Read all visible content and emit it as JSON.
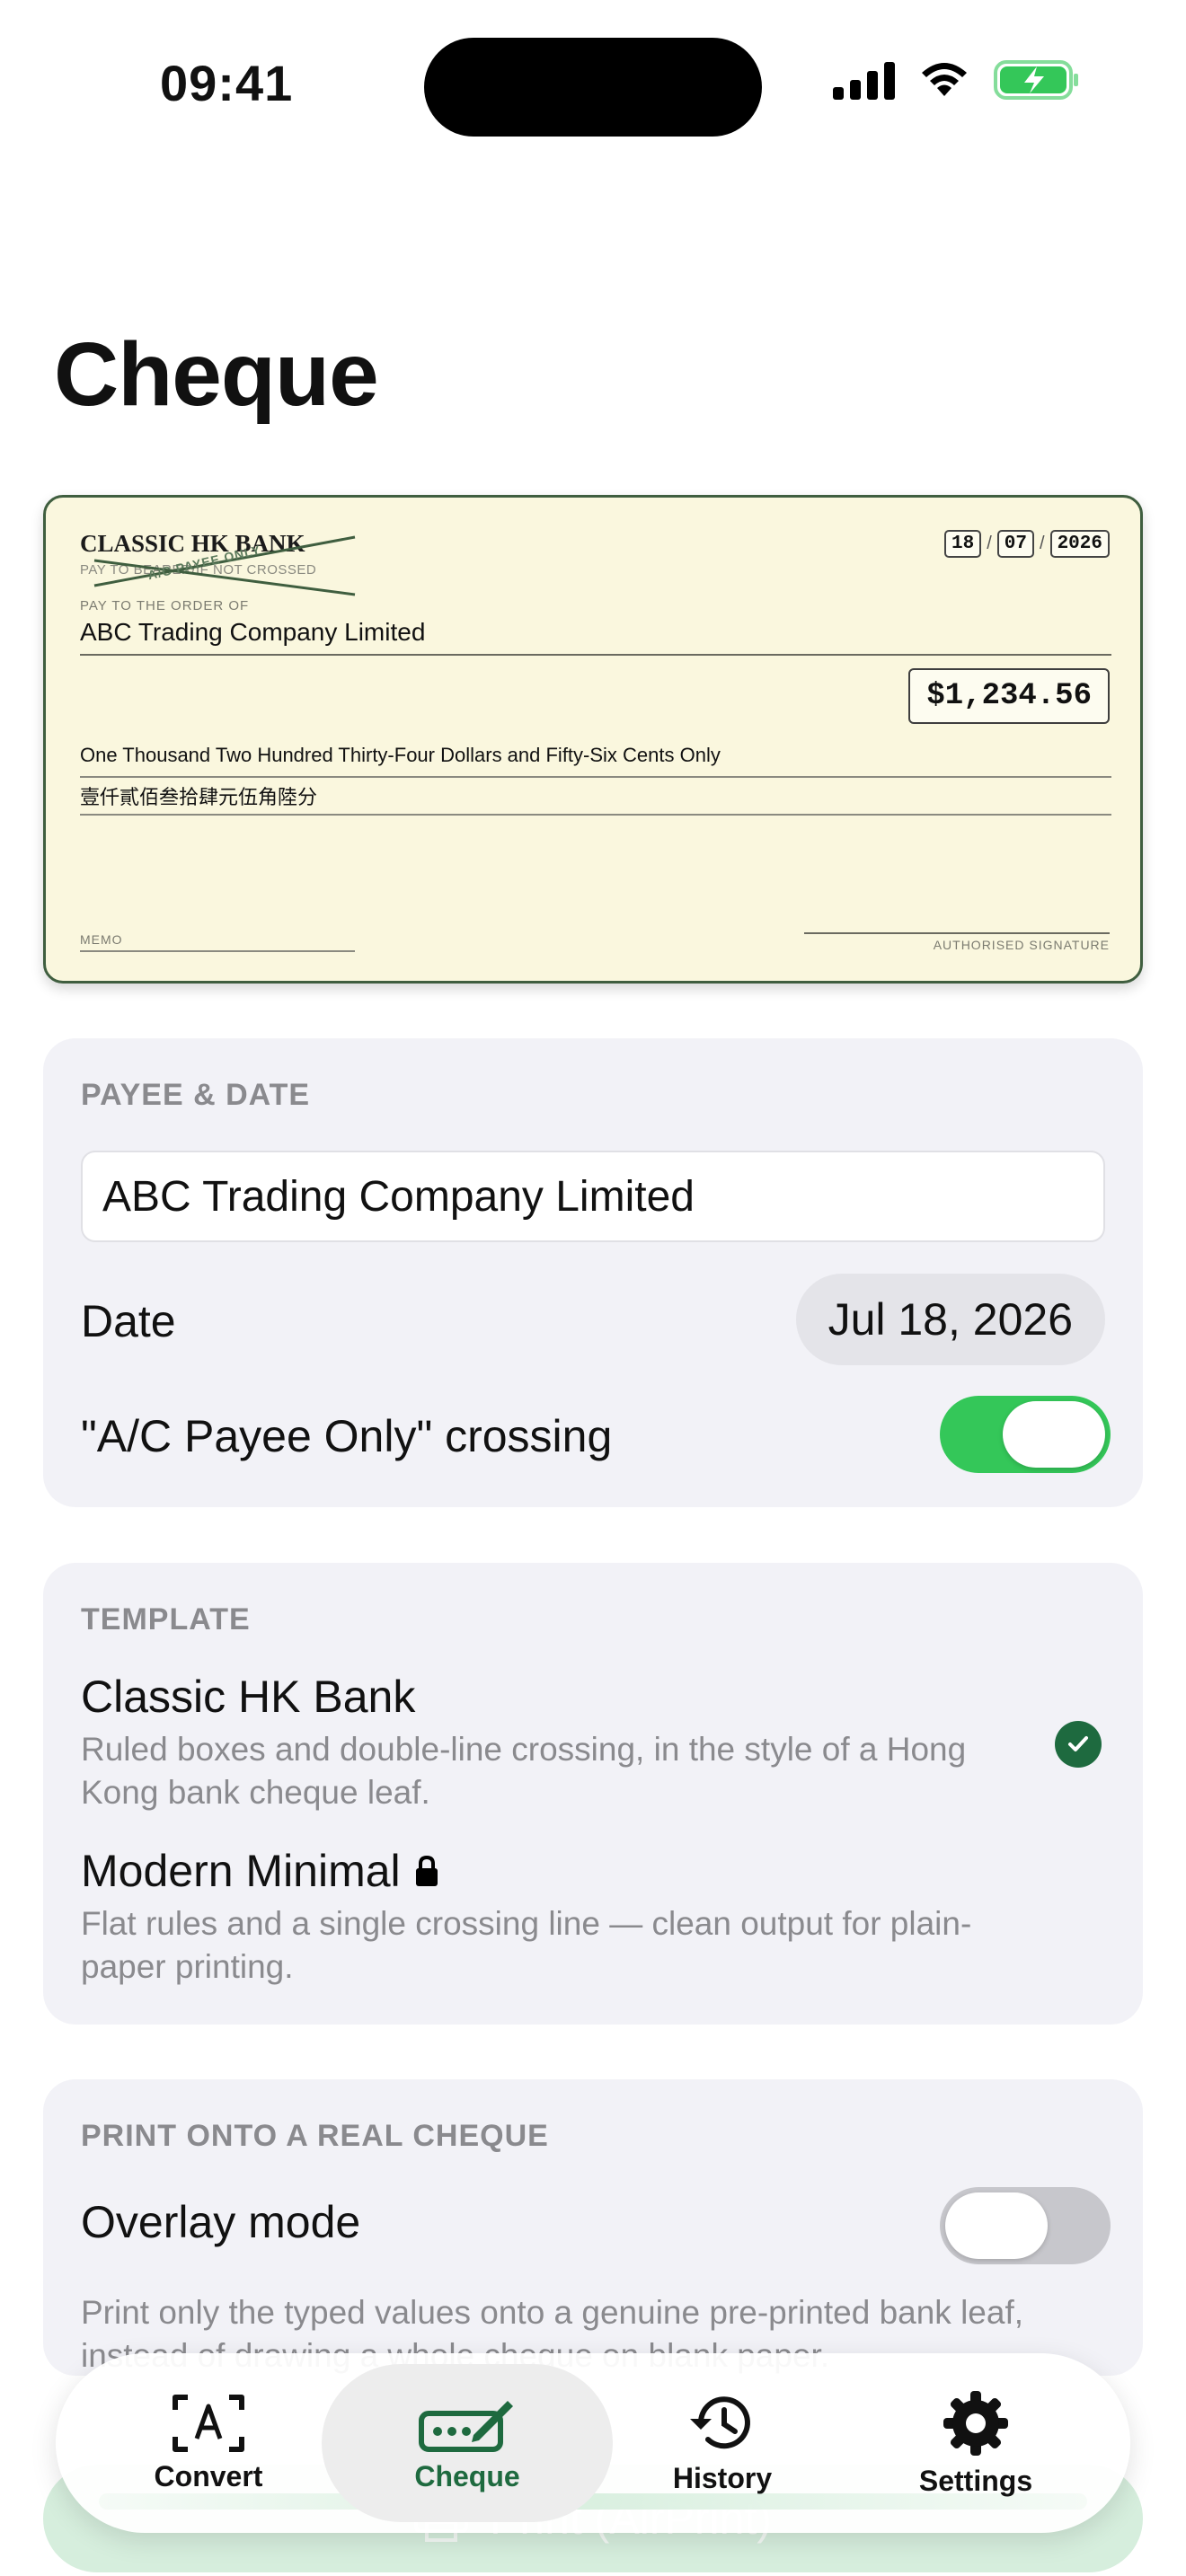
{
  "status": {
    "time": "09:41"
  },
  "title": "Cheque",
  "cheque": {
    "bank_name": "CLASSIC HK BANK",
    "bearer_text": "PAY TO BEARER/IF NOT CROSSED",
    "crossing_text": "A/C PAYEE ONLY",
    "date_day": "18",
    "date_month": "07",
    "date_year": "2026",
    "date_sep": "/",
    "pay_label": "PAY TO THE ORDER OF",
    "payee": "ABC Trading Company Limited",
    "amount": "$1,234.56",
    "words_en": "One Thousand Two Hundred Thirty-Four Dollars and Fifty-Six Cents Only",
    "words_zh": "壹仟貳佰叁拾肆元伍角陸分",
    "memo_label": "MEMO",
    "signature_label": "AUTHORISED SIGNATURE"
  },
  "payee_section": {
    "header": "PAYEE & DATE",
    "payee_value": "ABC Trading Company Limited",
    "date_label": "Date",
    "date_value": "Jul 18, 2026",
    "crossing_label": "\"A/C Payee Only\" crossing",
    "crossing_on": true
  },
  "template_section": {
    "header": "TEMPLATE",
    "templates": [
      {
        "name": "Classic HK Bank",
        "description": "Ruled boxes and double-line crossing, in the style of a Hong Kong bank cheque leaf.",
        "selected": true,
        "locked": false
      },
      {
        "name": "Modern Minimal",
        "description": "Flat rules and a single crossing line — clean output for plain-paper printing.",
        "selected": false,
        "locked": true
      }
    ]
  },
  "print_section": {
    "header": "PRINT ONTO A REAL CHEQUE",
    "overlay_label": "Overlay mode",
    "overlay_on": false,
    "overlay_description": "Print only the typed values onto a genuine pre-printed bank leaf, instead of drawing a whole cheque on blank paper."
  },
  "print_button": {
    "label": "Print (AirPrint)"
  },
  "tabs": [
    {
      "label": "Convert",
      "icon": "text-box-icon"
    },
    {
      "label": "Cheque",
      "icon": "signature-icon"
    },
    {
      "label": "History",
      "icon": "history-icon"
    },
    {
      "label": "Settings",
      "icon": "gear-icon"
    }
  ],
  "colors": {
    "accent": "#1e6a3f",
    "toggle_on": "#34c759",
    "cheque_paper": "#faf7de"
  }
}
